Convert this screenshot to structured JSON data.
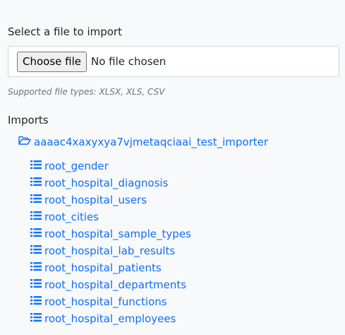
{
  "upload": {
    "label": "Select a file to import",
    "button_label": "Choose file",
    "status_text": "No file chosen",
    "supported_types": "Supported file types: XLSX, XLS, CSV"
  },
  "imports": {
    "heading": "Imports",
    "folder": {
      "name": "aaaac4xaxyxya7vjmetaqciaai_test_importer",
      "icon": "folder-open-icon"
    },
    "tables": [
      {
        "name": "root_gender",
        "icon": "table-list-icon"
      },
      {
        "name": "root_hospital_diagnosis",
        "icon": "table-list-icon"
      },
      {
        "name": "root_hospital_users",
        "icon": "table-list-icon"
      },
      {
        "name": "root_cities",
        "icon": "table-list-icon"
      },
      {
        "name": "root_hospital_sample_types",
        "icon": "table-list-icon"
      },
      {
        "name": "root_hospital_lab_results",
        "icon": "table-list-icon"
      },
      {
        "name": "root_hospital_patients",
        "icon": "table-list-icon"
      },
      {
        "name": "root_hospital_departments",
        "icon": "table-list-icon"
      },
      {
        "name": "root_hospital_functions",
        "icon": "table-list-icon"
      },
      {
        "name": "root_hospital_employees",
        "icon": "table-list-icon"
      }
    ]
  },
  "colors": {
    "link": "#0d6efd",
    "muted": "#6c757d",
    "background": "#f8f9fa"
  }
}
